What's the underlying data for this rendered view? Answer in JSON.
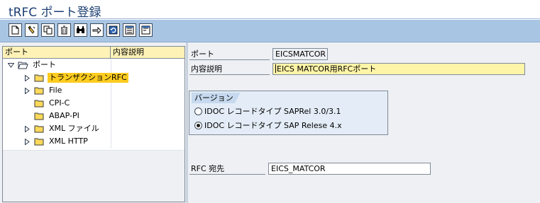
{
  "window": {
    "title": "tRFC ポート登録"
  },
  "toolbar": {
    "buttons": [
      {
        "icon": "new-document-icon"
      },
      {
        "icon": "edit-pencil-icon"
      },
      {
        "icon": "copy-icon"
      },
      {
        "icon": "delete-trash-icon"
      },
      {
        "icon": "binoculars-find-icon"
      },
      {
        "icon": "transport-icon"
      },
      {
        "icon": "refresh-icon"
      },
      {
        "icon": "expand-subtree-icon"
      },
      {
        "icon": "collapse-subtree-icon"
      }
    ]
  },
  "tree": {
    "columns": [
      "ポート",
      "内容説明"
    ],
    "root": {
      "label": "ポート",
      "expanded": true
    },
    "items": [
      {
        "label": "トランザクションRFC",
        "has_children": true,
        "selected": true
      },
      {
        "label": "File",
        "has_children": true
      },
      {
        "label": "CPI-C",
        "has_children": false
      },
      {
        "label": "ABAP-PI",
        "has_children": false
      },
      {
        "label": "XML ファイル",
        "has_children": true
      },
      {
        "label": "XML HTTP",
        "has_children": true
      }
    ]
  },
  "form": {
    "port_label": "ポート",
    "port_value": "EICSMATCOR",
    "description_label": "内容説明",
    "description_value": "EICS MATCOR用RFCポート",
    "version_group": {
      "title": "バージョン",
      "options": [
        {
          "label": "IDOC レコードタイプ SAPRel 3.0/3.1",
          "checked": false
        },
        {
          "label": "IDOC レコードタイプ SAP Relese 4.x",
          "checked": true
        }
      ]
    },
    "rfc_dest_label": "RFC 宛先",
    "rfc_dest_value": "EICS_MATCOR"
  },
  "colors": {
    "toolbar_bg": "#a9c5e4",
    "selected_item_bg": "#ffcc1f",
    "required_field_bg": "#fff5a8",
    "header_bg": "#fff2b7"
  }
}
